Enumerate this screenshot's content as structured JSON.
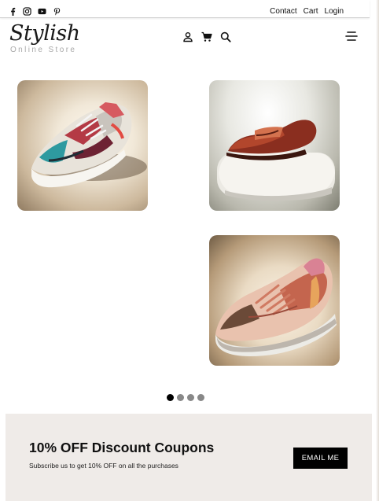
{
  "social": [
    {
      "name": "facebook-icon"
    },
    {
      "name": "instagram-icon"
    },
    {
      "name": "youtube-icon"
    },
    {
      "name": "pinterest-icon"
    }
  ],
  "top_links": [
    "Contact",
    "Cart",
    "Login"
  ],
  "logo": {
    "script": "Stylish",
    "subtitle": "Online Store"
  },
  "header_icons": [
    "user-icon",
    "cart-icon",
    "search-icon"
  ],
  "products": [
    {
      "name": "product-sneaker-colorful"
    },
    {
      "name": "product-loafer-brown"
    },
    {
      "name": "product-sneaker-pink"
    }
  ],
  "carousel": {
    "count": 4,
    "active_index": 0
  },
  "promo": {
    "title": "10% OFF Discount Coupons",
    "subtitle": "Subscribe us to get 10% OFF on all the purchases",
    "button": "EMAIL ME"
  },
  "colors": {
    "promo_bg": "#efebe8",
    "button_bg": "#000000",
    "dot_active": "#000000",
    "dot_inactive": "#888888"
  }
}
